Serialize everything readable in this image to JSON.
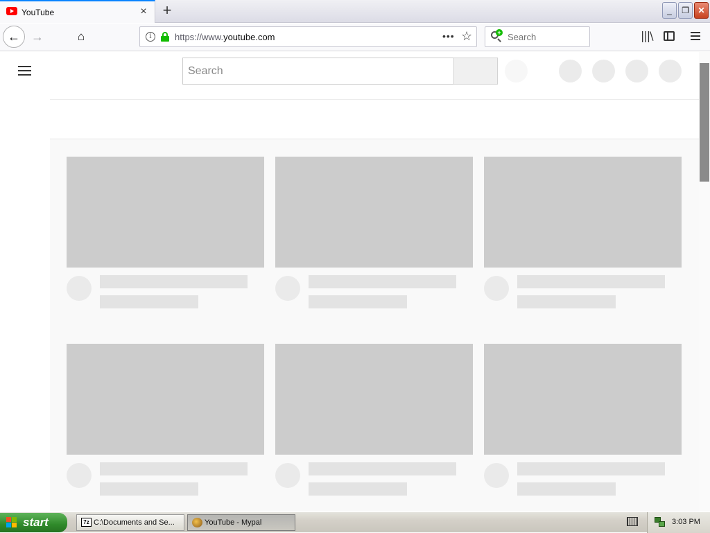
{
  "browser": {
    "tab_title": "YouTube",
    "tab_close_label": "×",
    "new_tab_label": "+",
    "url_scheme": "https://www.",
    "url_host": "youtube.com",
    "page_actions_label": "•••",
    "bookmark_star_label": "☆",
    "search_placeholder": "Search",
    "window_controls": {
      "minimize": "_",
      "restore": "❐",
      "close": "✕"
    },
    "icons": {
      "back": "←",
      "forward": "→",
      "home": "⌂",
      "library": "|||\\",
      "info": "i"
    }
  },
  "youtube": {
    "search_placeholder": "Search",
    "video_placeholder_rows": 2,
    "video_placeholder_columns": 3
  },
  "taskbar": {
    "start_label": "start",
    "icon_7z_label": "7z",
    "items": [
      {
        "label": "C:\\Documents and Se...",
        "active": false
      },
      {
        "label": "YouTube - Mypal",
        "active": true
      }
    ],
    "clock": "3:03 PM"
  },
  "colors": {
    "accent_tab": "#0a84ff",
    "lock_green": "#12bc00",
    "placeholder_thumb": "#cccccc",
    "start_green": "#2f8a2a"
  }
}
